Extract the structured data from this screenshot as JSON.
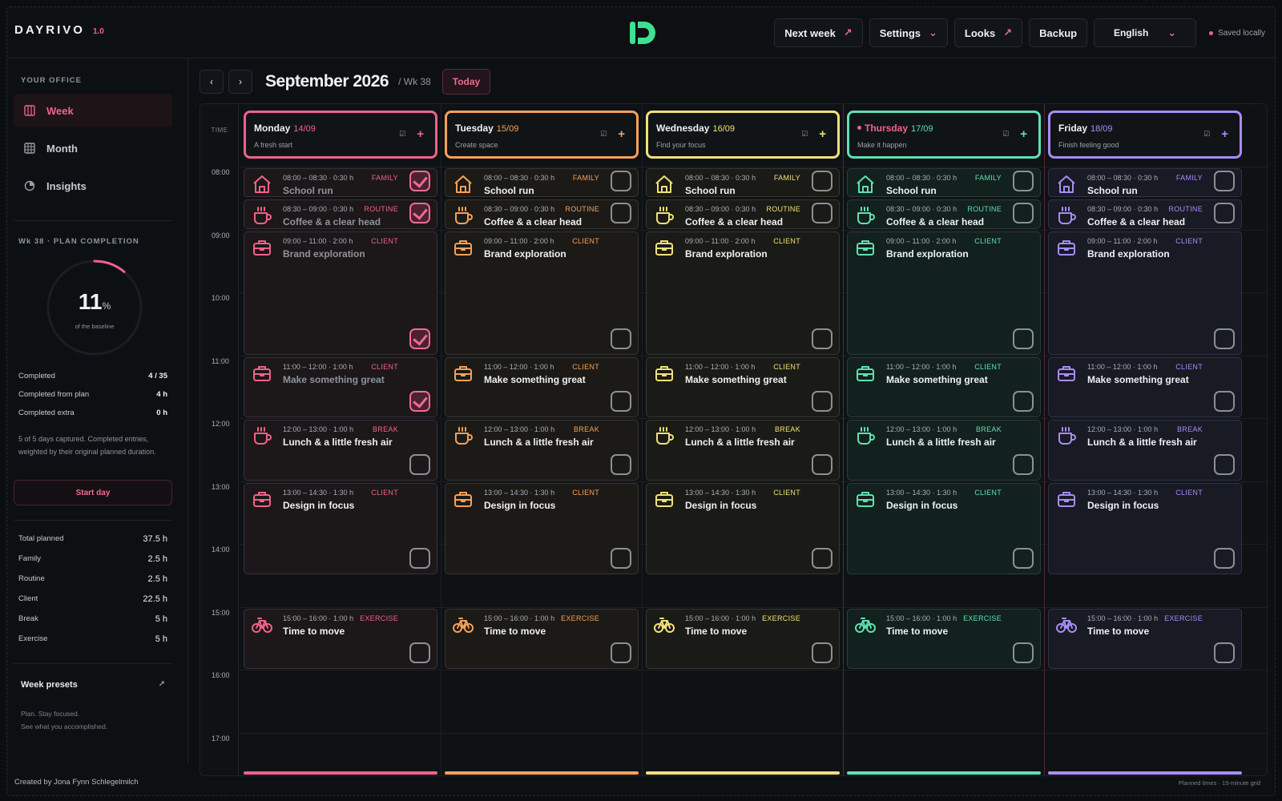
{
  "app": {
    "name": "DAYRIVO",
    "version": "1.0",
    "logo_icon": "dayrivo-logo-icon",
    "accent": "#f0628a"
  },
  "topbar": {
    "next_week": "Next week",
    "settings": "Settings",
    "looks": "Looks",
    "backup": "Backup",
    "language": "English",
    "saved": "Saved locally"
  },
  "sidebar": {
    "office_label": "YOUR OFFICE",
    "nav": [
      {
        "label": "Week",
        "icon": "week-grid-icon",
        "active": true
      },
      {
        "label": "Month",
        "icon": "month-grid-icon",
        "active": false
      },
      {
        "label": "Insights",
        "icon": "pie-chart-icon",
        "active": false
      }
    ],
    "completion_label": "Wk 38 · PLAN COMPLETION",
    "completion_value": "11",
    "completion_unit": "%",
    "completion_fraction": 0.11,
    "completion_sub": "of the baseline",
    "stats": [
      {
        "label": "Completed",
        "value": "4 / 35"
      },
      {
        "label": "Completed from plan",
        "value": "4 h"
      },
      {
        "label": "Completed extra",
        "value": "0 h"
      }
    ],
    "note": "5 of 5 days captured. Completed entries, weighted by their original planned duration.",
    "start_day": "Start day",
    "totals": [
      {
        "label": "Total planned",
        "value": "37.5 h"
      },
      {
        "label": "Family",
        "value": "2.5 h"
      },
      {
        "label": "Routine",
        "value": "2.5 h"
      },
      {
        "label": "Client",
        "value": "22.5 h"
      },
      {
        "label": "Break",
        "value": "5 h"
      },
      {
        "label": "Exercise",
        "value": "5 h"
      }
    ],
    "presets": "Week presets",
    "tagline_1": "Plan. Stay focused.",
    "tagline_2": "See what you accomplished."
  },
  "calendar": {
    "month": "September 2026",
    "week": "/ Wk 38",
    "today": "Today",
    "time_header": "TIME",
    "hours": [
      "08:00",
      "09:00",
      "10:00",
      "11:00",
      "12:00",
      "13:00",
      "14:00",
      "15:00",
      "16:00",
      "17:00"
    ],
    "days": [
      {
        "name": "Monday",
        "date": "14/09",
        "tagline": "A fresh start",
        "color": "#f0628a",
        "bg": "#1c1719",
        "border": "#3a3036",
        "now": false,
        "done": [
          0,
          1,
          2,
          3
        ]
      },
      {
        "name": "Tuesday",
        "date": "15/09",
        "tagline": "Create space",
        "color": "#f5a15a",
        "bg": "#1c1a17",
        "border": "#3a3530",
        "now": false,
        "done": []
      },
      {
        "name": "Wednesday",
        "date": "16/09",
        "tagline": "Find your focus",
        "color": "#f2e07a",
        "bg": "#1a1b16",
        "border": "#37382f",
        "now": false,
        "done": []
      },
      {
        "name": "Thursday",
        "date": "17/09",
        "tagline": "Make it happen",
        "color": "#5fe0b0",
        "bg": "#12211d",
        "border": "#2a3d37",
        "now": true,
        "done": []
      },
      {
        "name": "Friday",
        "date": "18/09",
        "tagline": "Finish feeling good",
        "color": "#a88cf5",
        "bg": "#181a24",
        "border": "#30344a",
        "now": false,
        "done": []
      }
    ],
    "events": [
      {
        "start": 8.0,
        "end": 8.5,
        "meta": "08:00 – 08:30 · 0:30 h",
        "cat": "FAMILY",
        "title": "School run",
        "icon": "house-icon"
      },
      {
        "start": 8.5,
        "end": 9.0,
        "meta": "08:30 – 09:00 · 0:30 h",
        "cat": "ROUTINE",
        "title": "Coffee & a clear head",
        "icon": "coffee-cup-icon"
      },
      {
        "start": 9.0,
        "end": 11.0,
        "meta": "09:00 – 11:00 · 2:00 h",
        "cat": "CLIENT",
        "title": "Brand exploration",
        "icon": "briefcase-icon"
      },
      {
        "start": 11.0,
        "end": 12.0,
        "meta": "11:00 – 12:00 · 1:00 h",
        "cat": "CLIENT",
        "title": "Make something great",
        "icon": "briefcase-icon"
      },
      {
        "start": 12.0,
        "end": 13.0,
        "meta": "12:00 – 13:00 · 1:00 h",
        "cat": "BREAK",
        "title": "Lunch & a little fresh air",
        "icon": "coffee-cup-icon"
      },
      {
        "start": 13.0,
        "end": 14.5,
        "meta": "13:00 – 14:30 · 1:30 h",
        "cat": "CLIENT",
        "title": "Design in focus",
        "icon": "briefcase-icon"
      },
      {
        "start": 15.0,
        "end": 16.0,
        "meta": "15:00 – 16:00 · 1:00 h",
        "cat": "EXERCISE",
        "title": "Time to move",
        "icon": "bicycle-icon"
      }
    ]
  },
  "footer": {
    "credit": "Created by Jona Fynn Schlegelmilch",
    "grid_note": "Planned times · 15-minute grid"
  }
}
